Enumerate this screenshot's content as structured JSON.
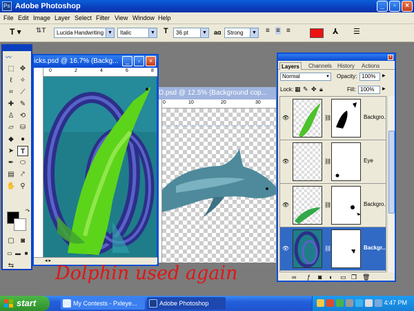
{
  "app": {
    "title": "Adobe Photoshop",
    "window_controls": [
      "minimize",
      "restore",
      "close"
    ]
  },
  "menu": [
    "File",
    "Edit",
    "Image",
    "Layer",
    "Select",
    "Filter",
    "View",
    "Window",
    "Help"
  ],
  "options_bar": {
    "font_family": "Lucida Handwriting",
    "font_style": "Italic",
    "font_size": "36 pt",
    "anti_alias_label": "aɑ",
    "anti_alias": "Strong",
    "text_color": "#ee1111"
  },
  "documents": [
    {
      "title": "icks.psd @ 16.7% (Backg...",
      "ruler_labels": [
        "0",
        "2",
        "4",
        "6",
        "8"
      ]
    },
    {
      "title": "D.psd @ 12.5% (Background cop...",
      "ruler_labels": [
        "0",
        "10",
        "20",
        "30"
      ]
    }
  ],
  "layers_panel": {
    "tabs": [
      "Layers",
      "Channels",
      "History",
      "Actions"
    ],
    "blend_mode": "Normal",
    "opacity_label": "Opacity:",
    "opacity": "100%",
    "lock_label": "Lock:",
    "fill_label": "Fill:",
    "fill": "100%",
    "layers": [
      {
        "name": "Backgro...",
        "selected": false
      },
      {
        "name": "Eye",
        "selected": false
      },
      {
        "name": "Backgro...",
        "selected": false
      },
      {
        "name": "Backgr...",
        "selected": true
      }
    ]
  },
  "caption": "Dolphin used again",
  "taskbar": {
    "start": "start",
    "items": [
      "My Contests - Pxleye...",
      "Adobe Photoshop"
    ],
    "clock": "4:47 PM"
  }
}
